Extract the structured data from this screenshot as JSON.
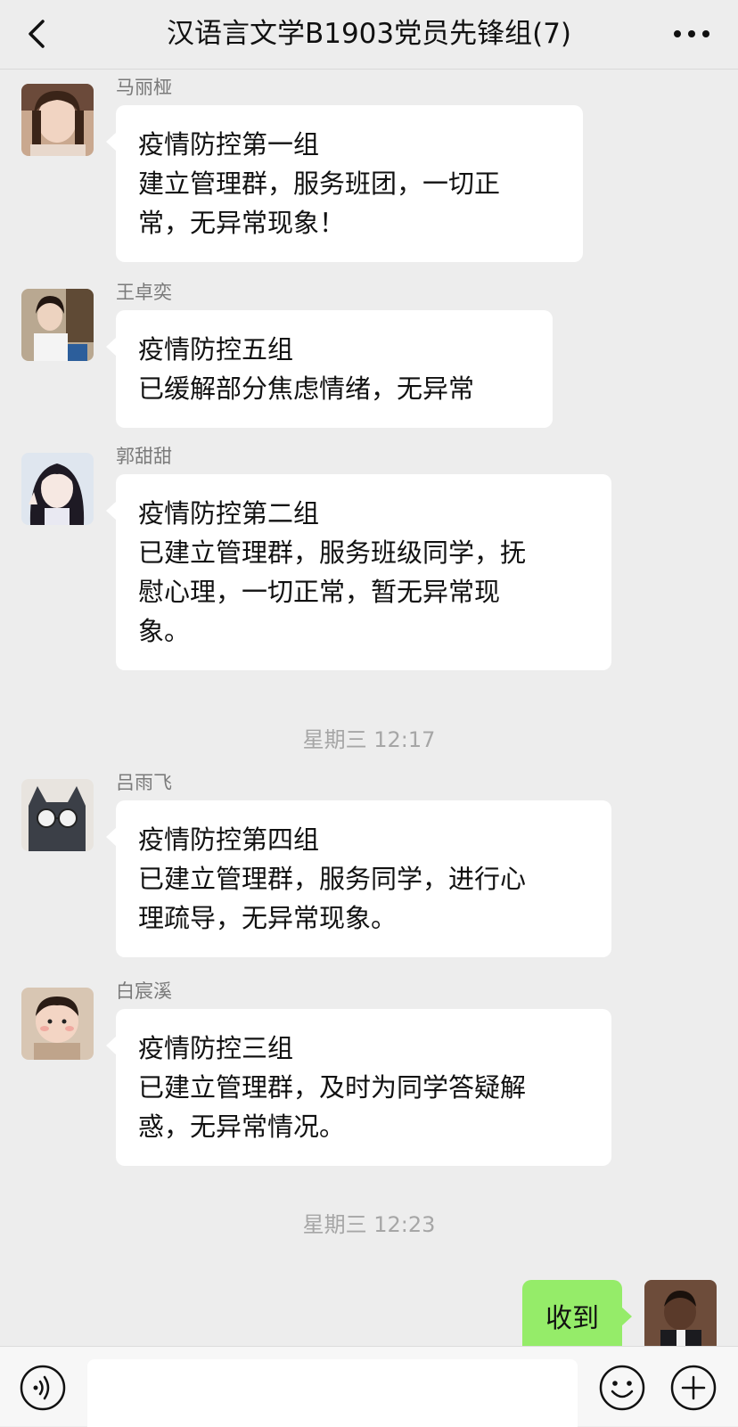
{
  "header": {
    "title": "汉语言文学B1903党员先锋组(7)"
  },
  "messages": [
    {
      "sender": "马丽桠",
      "lines": [
        "疫情防控第一组",
        "建立管理群，服务班团，一切正",
        "常，无异常现象！"
      ]
    },
    {
      "sender": "王卓奕",
      "lines": [
        "疫情防控五组",
        "已缓解部分焦虑情绪，无异常"
      ]
    },
    {
      "sender": "郭甜甜",
      "lines": [
        "疫情防控第二组",
        "已建立管理群，服务班级同学，抚",
        "慰心理，一切正常，暂无异常现",
        "象。"
      ]
    },
    {
      "sender": "吕雨飞",
      "lines": [
        "疫情防控第四组",
        "已建立管理群，服务同学，进行心",
        "理疏导，无异常现象。"
      ]
    },
    {
      "sender": "白宸溪",
      "lines": [
        "疫情防控三组",
        "已建立管理群，及时为同学答疑解",
        "惑，无异常情况。"
      ]
    }
  ],
  "timestamps": [
    "星期三 12:17",
    "星期三 12:23"
  ],
  "my_message": {
    "text": "收到"
  },
  "input": {
    "value": ""
  },
  "colors": {
    "background": "#ededed",
    "incoming_bubble": "#ffffff",
    "outgoing_bubble": "#95ec69",
    "sender_name": "#7a7a7a",
    "timestamp": "#a6a6a6"
  },
  "icons": {
    "back": "chevron-left-icon",
    "more": "more-dots-icon",
    "voice": "voice-icon",
    "emoji": "emoji-icon",
    "plus": "plus-icon"
  }
}
